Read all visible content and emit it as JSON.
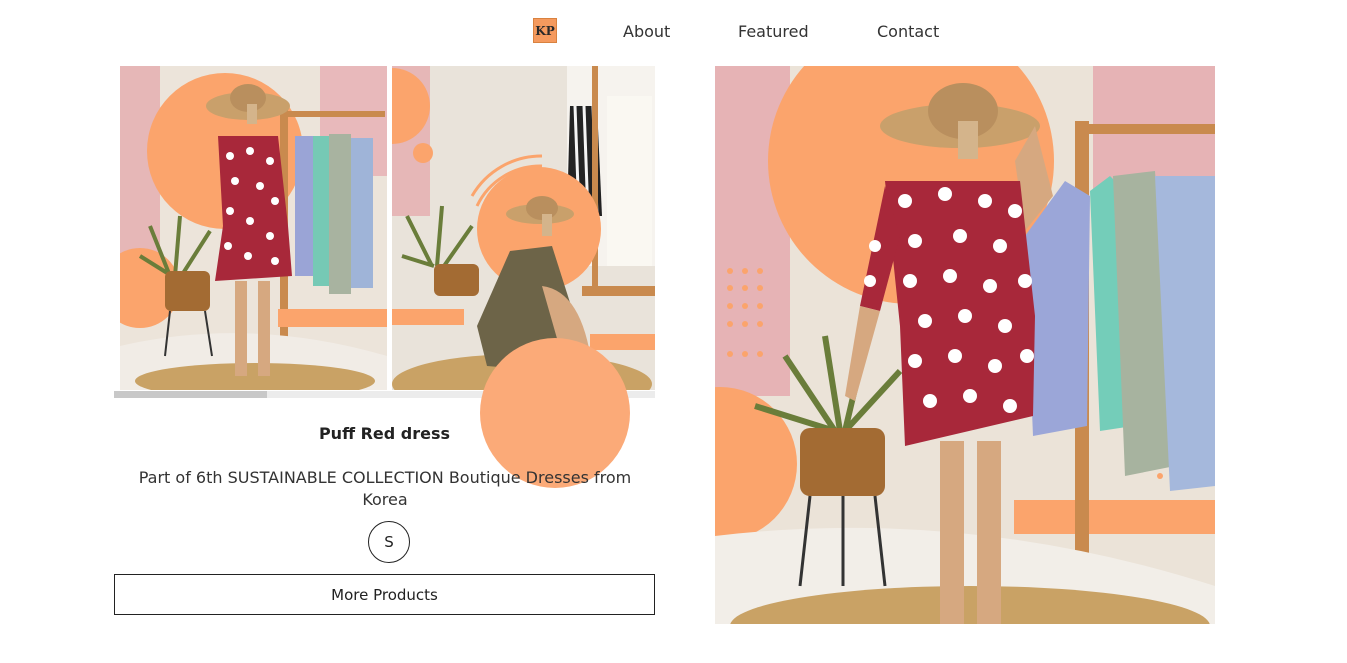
{
  "nav": {
    "logo_text": "KP",
    "links": [
      "About",
      "Featured",
      "Contact"
    ]
  },
  "product": {
    "title": "Puff Red dress",
    "description": "Part of 6th SUSTAINABLE COLLECTION Boutique Dresses from Korea",
    "size": "S",
    "more_button": "More Products"
  },
  "colors": {
    "accent": "#f59a5e",
    "dress": "#a8283a"
  }
}
